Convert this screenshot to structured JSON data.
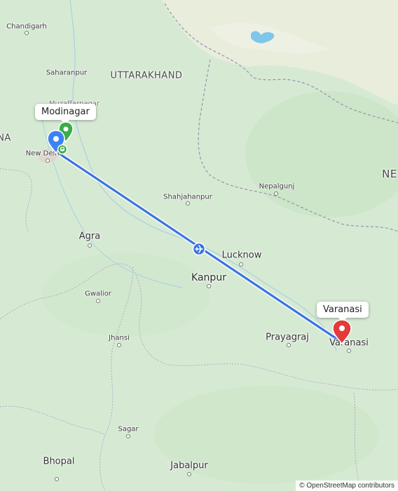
{
  "map": {
    "cities": {
      "chandigarh": "Chandigarh",
      "saharanpur": "Saharanpur",
      "muzaffarnagar": "Muzaffarnagar",
      "new_delhi": "New Delhi",
      "shahjahanpur": "Shahjahanpur",
      "nepalgunj": "Nepalgunj",
      "agra": "Agra",
      "lucknow": "Lucknow",
      "kanpur": "Kanpur",
      "gwalior": "Gwalior",
      "prayagraj": "Prayagraj",
      "varanasi": "Varanasi",
      "jhansi": "Jhansi",
      "sagar": "Sagar",
      "bhopal": "Bhopal",
      "jabalpur": "Jabalpur"
    },
    "regions": {
      "uttarakhand": "UTTARAKHAND",
      "nepal_partial": "NE",
      "india_partial": "NA"
    },
    "route": {
      "origin_label": "Modinagar",
      "destination_label": "Varanasi",
      "mode": "flight",
      "origin_marker_color": "#3b82f6",
      "destination_marker_color": "#e23b3b",
      "route_color": "#3b74e0",
      "station_marker_color": "#3aad4a"
    },
    "icons": [
      "origin-pin-icon",
      "destination-pin-icon",
      "airplane-icon",
      "station-pin-icon",
      "train-icon"
    ],
    "attribution": "© OpenStreetMap contributors"
  }
}
